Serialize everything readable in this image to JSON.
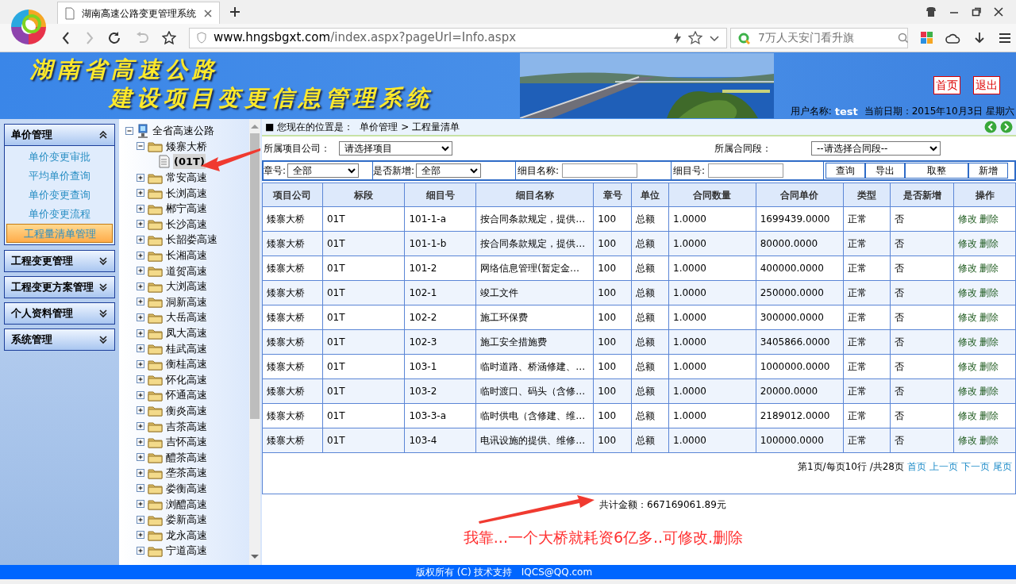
{
  "browser": {
    "tab_title": "湖南高速公路变更管理系统",
    "url_host": "www.hngsbgxt.com",
    "url_path": "/index.aspx?pageUrl=Info.aspx",
    "search_placeholder": "7万人天安门看升旗"
  },
  "header": {
    "title_lines": [
      "湖南省高速公路",
      "建设项目变更信息管理系统"
    ],
    "links": [
      "首页",
      "退出"
    ],
    "user_label": "用户名称:",
    "user_name": "test",
    "date_text": "当前日期：2015年10月3日 星期六"
  },
  "menu": [
    {
      "title": "单价管理",
      "expanded": true,
      "items": [
        {
          "label": "单价变更审批",
          "selected": false
        },
        {
          "label": "平均单价查询",
          "selected": false
        },
        {
          "label": "单价变更查询",
          "selected": false
        },
        {
          "label": "单价变更流程",
          "selected": false
        },
        {
          "label": "工程量清单管理",
          "selected": true
        }
      ]
    },
    {
      "title": "工程变更管理",
      "expanded": false
    },
    {
      "title": "工程变更方案管理",
      "expanded": false
    },
    {
      "title": "个人资料管理",
      "expanded": false
    },
    {
      "title": "系统管理",
      "expanded": false
    }
  ],
  "tree": {
    "label": "全省高速公路",
    "expanded": true,
    "children": [
      {
        "label": "矮寨大桥",
        "expanded": true,
        "children": [
          {
            "label": "(01T)",
            "selected": true
          }
        ]
      },
      {
        "label": "常安高速",
        "expanded": false
      },
      {
        "label": "长浏高速",
        "expanded": false
      },
      {
        "label": "郴宁高速",
        "expanded": false
      },
      {
        "label": "长沙高速",
        "expanded": false
      },
      {
        "label": "长韶娄高速",
        "expanded": false
      },
      {
        "label": "长湘高速",
        "expanded": false
      },
      {
        "label": "道贺高速",
        "expanded": false
      },
      {
        "label": "大浏高速",
        "expanded": false
      },
      {
        "label": "洞新高速",
        "expanded": false
      },
      {
        "label": "大岳高速",
        "expanded": false
      },
      {
        "label": "凤大高速",
        "expanded": false
      },
      {
        "label": "桂武高速",
        "expanded": false
      },
      {
        "label": "衡桂高速",
        "expanded": false
      },
      {
        "label": "怀化高速",
        "expanded": false
      },
      {
        "label": "怀通高速",
        "expanded": false
      },
      {
        "label": "衡炎高速",
        "expanded": false
      },
      {
        "label": "吉茶高速",
        "expanded": false
      },
      {
        "label": "吉怀高速",
        "expanded": false
      },
      {
        "label": "醴茶高速",
        "expanded": false
      },
      {
        "label": "垄茶高速",
        "expanded": false
      },
      {
        "label": "娄衡高速",
        "expanded": false
      },
      {
        "label": "浏醴高速",
        "expanded": false
      },
      {
        "label": "娄新高速",
        "expanded": false
      },
      {
        "label": "龙永高速",
        "expanded": false
      },
      {
        "label": "宁道高速",
        "expanded": false
      }
    ]
  },
  "breadcrumb": {
    "marker": "■",
    "label": "您现在的位置是：",
    "path": "单价管理 > 工程量清单"
  },
  "filters": {
    "company_label": "所属项目公司：",
    "company_value": "请选择项目",
    "section_label": "所属合同段：",
    "section_value": "--请选择合同段--",
    "chapter_label": "章号:",
    "chapter_value": "全部",
    "new_label": "是否新增:",
    "new_value": "全部",
    "item_name_label": "细目名称:",
    "item_no_label": "细目号:",
    "buttons": [
      "查询",
      "导出",
      "取整",
      "新增"
    ]
  },
  "table": {
    "columns": [
      "项目公司",
      "标段",
      "细目号",
      "细目名称",
      "章号",
      "单位",
      "合同数量",
      "合同单价",
      "类型",
      "是否新增",
      "操作"
    ],
    "rows": [
      {
        "cells": [
          "矮寨大桥",
          "01T",
          "101-1-a",
          "按合同条款规定，提供…",
          "100",
          "总额",
          "1.0000",
          "1699439.0000",
          "正常",
          "否"
        ],
        "actions": [
          "修改",
          "删除"
        ]
      },
      {
        "cells": [
          "矮寨大桥",
          "01T",
          "101-1-b",
          "按合同条款规定，提供…",
          "100",
          "总额",
          "1.0000",
          "80000.0000",
          "正常",
          "否"
        ],
        "actions": [
          "修改",
          "删除"
        ]
      },
      {
        "cells": [
          "矮寨大桥",
          "01T",
          "101-2",
          "网络信息管理(暂定金…",
          "100",
          "总额",
          "1.0000",
          "400000.0000",
          "正常",
          "否"
        ],
        "actions": [
          "修改",
          "删除"
        ]
      },
      {
        "cells": [
          "矮寨大桥",
          "01T",
          "102-1",
          "竣工文件",
          "100",
          "总额",
          "1.0000",
          "250000.0000",
          "正常",
          "否"
        ],
        "actions": [
          "修改",
          "删除"
        ]
      },
      {
        "cells": [
          "矮寨大桥",
          "01T",
          "102-2",
          "施工环保费",
          "100",
          "总额",
          "1.0000",
          "300000.0000",
          "正常",
          "否"
        ],
        "actions": [
          "修改",
          "删除"
        ]
      },
      {
        "cells": [
          "矮寨大桥",
          "01T",
          "102-3",
          "施工安全措施费",
          "100",
          "总额",
          "1.0000",
          "3405866.0000",
          "正常",
          "否"
        ],
        "actions": [
          "修改",
          "删除"
        ]
      },
      {
        "cells": [
          "矮寨大桥",
          "01T",
          "103-1",
          "临时道路、桥涵修建、…",
          "100",
          "总额",
          "1.0000",
          "1000000.0000",
          "正常",
          "否"
        ],
        "actions": [
          "修改",
          "删除"
        ]
      },
      {
        "cells": [
          "矮寨大桥",
          "01T",
          "103-2",
          "临时渡口、码头（含修…",
          "100",
          "总额",
          "1.0000",
          "20000.0000",
          "正常",
          "否"
        ],
        "actions": [
          "修改",
          "删除"
        ]
      },
      {
        "cells": [
          "矮寨大桥",
          "01T",
          "103-3-a",
          "临时供电（含修建、维…",
          "100",
          "总额",
          "1.0000",
          "2189012.0000",
          "正常",
          "否"
        ],
        "actions": [
          "修改",
          "删除"
        ]
      },
      {
        "cells": [
          "矮寨大桥",
          "01T",
          "103-4",
          "电讯设施的提供、维修…",
          "100",
          "总额",
          "1.0000",
          "100000.0000",
          "正常",
          "否"
        ],
        "actions": [
          "修改",
          "删除"
        ]
      }
    ]
  },
  "pagination": {
    "summary": "第1页/每页10行 /共28页",
    "links": [
      "首页",
      "上一页",
      "下一页",
      "尾页"
    ]
  },
  "total": "共计金额：667169061.89元",
  "annotation": "我靠...一个大桥就耗资6亿多..可修改.删除",
  "footer": "版权所有 (C) 技术支持   IQCS@QQ.com"
}
